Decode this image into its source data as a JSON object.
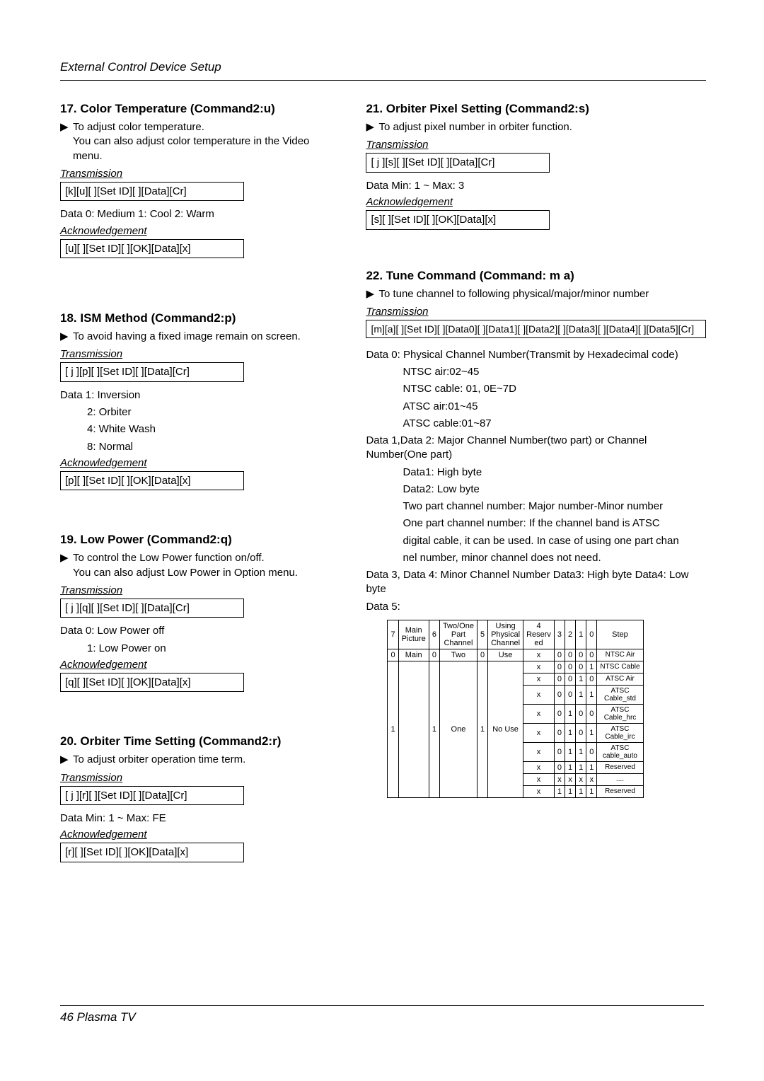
{
  "running_head": "External Control Device Setup",
  "footer": "46  Plasma TV",
  "s17": {
    "title": "17. Color Temperature (Command2:u)",
    "p1a": "To adjust color temperature.",
    "p1b": "You can also adjust color temperature in the Video menu.",
    "trans_label": "Transmission",
    "trans_cmd": "[k][u][  ][Set ID][  ][Data][Cr]",
    "data1": "Data  0: Medium    1: Cool   2: Warm",
    "ack_label": "Acknowledgement",
    "ack_cmd": "[u][  ][Set ID][  ][OK][Data][x]"
  },
  "s18": {
    "title": "18. ISM Method (Command2:p)",
    "p1": "To avoid having a fixed image remain on screen.",
    "trans_label": "Transmission",
    "trans_cmd": "[ j ][p][  ][Set ID][  ][Data][Cr]",
    "d1": "Data  1: Inversion",
    "d2": "2: Orbiter",
    "d3": "4: White Wash",
    "d4": "8: Normal",
    "ack_label": "Acknowledgement",
    "ack_cmd": "[p][  ][Set ID][  ][OK][Data][x]"
  },
  "s19": {
    "title": "19. Low Power (Command2:q)",
    "p1a": "To control the Low Power function on/off.",
    "p1b": "You can also adjust Low Power in Option menu.",
    "trans_label": "Transmission",
    "trans_cmd": "[ j ][q][  ][Set ID][  ][Data][Cr]",
    "d1": "Data  0: Low Power off",
    "d2": "1: Low Power on",
    "ack_label": "Acknowledgement",
    "ack_cmd": "[q][  ][Set ID][  ][OK][Data][x]"
  },
  "s20": {
    "title": "20. Orbiter Time Setting (Command2:r)",
    "p1": "To adjust orbiter operation time term.",
    "trans_label": "Transmission",
    "trans_cmd": "[ j ][r][  ][Set ID][  ][Data][Cr]",
    "d1": "Data   Min: 1 ~ Max: FE",
    "ack_label": "Acknowledgement",
    "ack_cmd": "[r][  ][Set ID][  ][OK][Data][x]"
  },
  "s21": {
    "title": "21. Orbiter Pixel Setting (Command2:s)",
    "p1": "To adjust pixel number in orbiter function.",
    "trans_label": "Transmission",
    "trans_cmd": "[ j ][s][  ][Set ID][  ][Data][Cr]",
    "d1": "Data   Min: 1 ~ Max: 3",
    "ack_label": "Acknowledgement",
    "ack_cmd": "[s][  ][Set ID][  ][OK][Data][x]"
  },
  "s22": {
    "title": "22. Tune Command (Command: m a)",
    "p1": "To tune channel to following physical/major/minor number",
    "trans_label": "Transmission",
    "trans_cmd": "[m][a][ ][Set ID][ ][Data0][ ][Data1][ ][Data2][ ][Data3][ ][Data4][ ][Data5][Cr]",
    "d0_a": "Data  0: Physical Channel Number(Transmit by Hexadecimal code)",
    "d0_b": "NTSC air:02~45",
    "d0_c": "NTSC cable: 01, 0E~7D",
    "d0_d": "ATSC air:01~45",
    "d0_e": "ATSC cable:01~87",
    "d12_a": "Data 1,Data 2: Major Channel Number(two part) or Channel Number(One part)",
    "d12_b": "Data1: High byte",
    "d12_c": "Data2: Low byte",
    "d12_d": "Two part channel number: Major number-Minor number",
    "d12_e": "One part channel number: If the channel band is ATSC",
    "d12_f": "digital cable, it can be used. In case of using one part chan",
    "d12_g": "nel number, minor channel does not need.",
    "d34": "Data 3, Data 4: Minor Channel Number Data3: High byte Data4: Low byte",
    "d5_label": "Data 5:",
    "table": {
      "head_row": [
        "7",
        "Main\nPicture",
        "6",
        "Two/One\nPart\nChannel",
        "5",
        "Using\nPhysical\nChannel",
        "4\nReserv\ned",
        "3",
        "2",
        "1",
        "0",
        "Step"
      ],
      "r1": [
        "0",
        "Main",
        "0",
        "Two",
        "0",
        "Use",
        "x",
        "0",
        "0",
        "0",
        "0",
        "NTSC Air"
      ],
      "r2": [
        "1",
        "",
        "1",
        "One",
        "1",
        "No Use",
        "x",
        "0",
        "0",
        "0",
        "1",
        "NTSC Cable"
      ],
      "r3": [
        "",
        "",
        "",
        "",
        "",
        "",
        "x",
        "0",
        "0",
        "1",
        "0",
        "ATSC Air"
      ],
      "r4": [
        "",
        "",
        "",
        "",
        "",
        "",
        "x",
        "0",
        "0",
        "1",
        "1",
        "ATSC\nCable_std"
      ],
      "r5": [
        "",
        "",
        "",
        "",
        "",
        "",
        "x",
        "0",
        "1",
        "0",
        "0",
        "ATSC\nCable_hrc"
      ],
      "r6": [
        "",
        "",
        "",
        "",
        "",
        "",
        "x",
        "0",
        "1",
        "0",
        "1",
        "ATSC\nCable_irc"
      ],
      "r7": [
        "",
        "",
        "",
        "",
        "",
        "",
        "x",
        "0",
        "1",
        "1",
        "0",
        "ATSC\ncable_auto"
      ],
      "r8": [
        "",
        "",
        "",
        "",
        "",
        "",
        "x",
        "0",
        "1",
        "1",
        "1",
        "Reserved"
      ],
      "r9": [
        "",
        "",
        "",
        "",
        "",
        "",
        "x",
        "x",
        "x",
        "x",
        "x",
        "...."
      ],
      "r10": [
        "",
        "",
        "",
        "",
        "",
        "",
        "x",
        "1",
        "1",
        "1",
        "1",
        "Reserved"
      ]
    }
  }
}
